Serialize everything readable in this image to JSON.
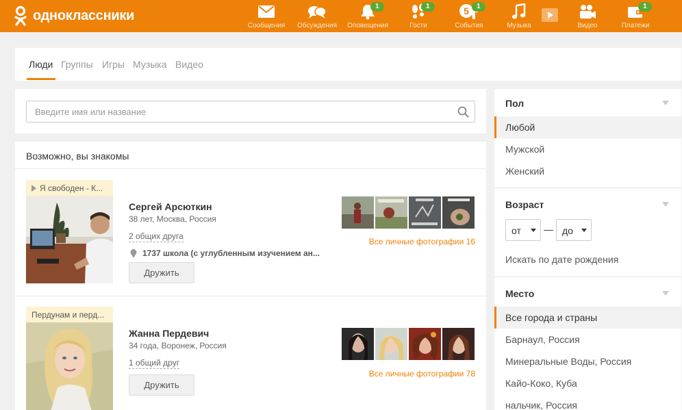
{
  "header": {
    "logo_text": "одноклассники",
    "nav": [
      {
        "label": "Сообщения",
        "icon": "envelope-icon",
        "badge": ""
      },
      {
        "label": "Обсуждения",
        "icon": "speech-bubbles-icon",
        "badge": ""
      },
      {
        "label": "Оповещения",
        "icon": "bell-icon",
        "badge": "1"
      },
      {
        "label": "Гости",
        "icon": "footprints-icon",
        "badge": "1"
      },
      {
        "label": "События",
        "icon": "events-icon",
        "badge": "1"
      },
      {
        "label": "Музыка",
        "icon": "music-note-icon",
        "badge": ""
      },
      {
        "label": "Видео",
        "icon": "video-camera-icon",
        "badge": ""
      },
      {
        "label": "Платежи",
        "icon": "wallet-icon",
        "badge": "1"
      }
    ]
  },
  "tabs": [
    "Люди",
    "Группы",
    "Игры",
    "Музыка",
    "Видео"
  ],
  "search": {
    "placeholder": "Введите имя или название"
  },
  "people": {
    "title": "Возможно, вы знакомы",
    "items": [
      {
        "status": "Я свободен - К...",
        "name": "Сергей Арсюткин",
        "info": "38 лет, Москва, Россия",
        "friends": "2 общих друга",
        "school": "1737 школа (с углубленным изучением ан...",
        "button": "Дружить",
        "photos_link": "Все личные фотографии 16"
      },
      {
        "status": "Пердунам и перд...",
        "name": "Жанна Пердевич",
        "info": "34 года, Воронеж, Россия",
        "friends": "1 общий друг",
        "button": "Дружить",
        "photos_link": "Все личные фотографии 78"
      }
    ]
  },
  "filters": {
    "gender": {
      "title": "Пол",
      "options": [
        "Любой",
        "Мужской",
        "Женский"
      ]
    },
    "age": {
      "title": "Возраст",
      "from": "от",
      "to": "до",
      "dash": "—",
      "birthdate": "Искать по дате рождения"
    },
    "place": {
      "title": "Место",
      "options": [
        "Все города и страны",
        "Барнаул, Россия",
        "Минеральные Воды, Россия",
        "Кайо-Коко, Куба",
        "нальчик, Россия"
      ]
    }
  },
  "colors": {
    "brand": "#ee8208",
    "badge": "#5ea830"
  }
}
